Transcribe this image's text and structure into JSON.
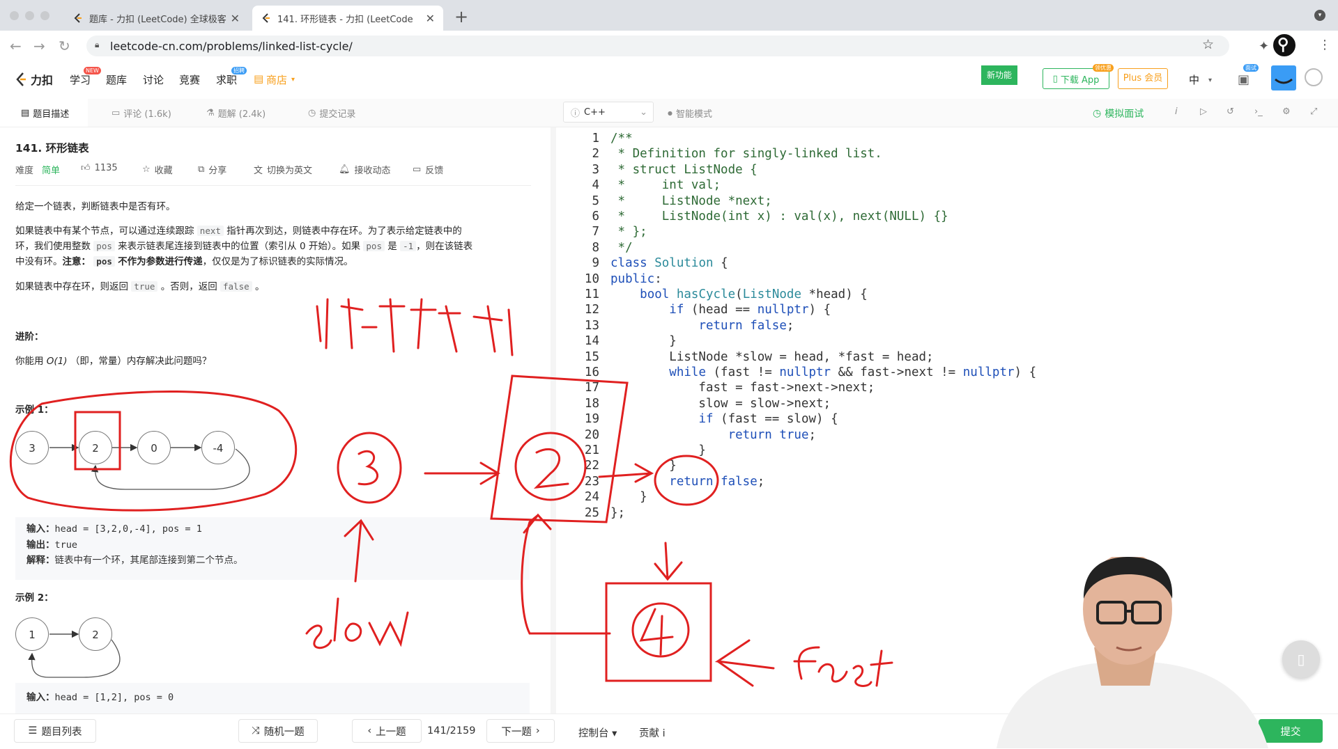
{
  "browser": {
    "tabs": [
      {
        "title": "题库 - 力扣 (LeetCode) 全球极客",
        "active": false
      },
      {
        "title": "141. 环形链表 - 力扣 (LeetCode",
        "active": true
      }
    ],
    "new_tab": "+",
    "url": "leetcode-cn.com/problems/linked-list-cycle/"
  },
  "site_header": {
    "logo_text": "力扣",
    "nav": [
      {
        "label": "学习",
        "badge": "NEW"
      },
      {
        "label": "题库"
      },
      {
        "label": "讨论"
      },
      {
        "label": "竞赛"
      },
      {
        "label": "求职",
        "badge": "招聘"
      },
      {
        "label": "商店"
      }
    ],
    "new_feature": "新功能",
    "download_app": "下载 App",
    "download_badge": "领优惠",
    "plus": "Plus 会员",
    "lang": "中",
    "interview_badge": "面试"
  },
  "sub_toolbar": {
    "tabs": [
      "题目描述",
      "评论 (1.6k)",
      "题解 (2.4k)",
      "提交记录"
    ],
    "language": "C++",
    "smart_mode": "智能模式",
    "mock_interview": "模拟面试"
  },
  "problem": {
    "title": "141. 环形链表",
    "difficulty_label": "难度",
    "difficulty": "简单",
    "likes": "1135",
    "favorite": "收藏",
    "share": "分享",
    "switch_english": "切换为英文",
    "subscribe": "接收动态",
    "feedback": "反馈",
    "desc_1": "给定一个链表，判断链表中是否有环。",
    "desc_2_a": "如果链表中有某个节点，可以通过连续跟踪",
    "code_next": "next",
    "desc_2_b": "指针再次到达，则链表中存在环。为了表示给定链表中的",
    "desc_2_c": "环，我们使用整数",
    "code_pos": "pos",
    "desc_2_d": "来表示链表尾连接到链表中的位置（索引从 0 开始）。如果",
    "desc_2_e": "是",
    "code_neg1": "-1",
    "desc_2_f": "，则在该链表",
    "desc_2_g": "中没有环。",
    "desc_2_note": "注意：",
    "desc_2_h": "不作为参数进行传递",
    "desc_2_i": "，仅仅是为了标识链表的实际情况。",
    "desc_3_a": "如果链表中存在环，则返回",
    "code_true": "true",
    "desc_3_b": "。否则，返回",
    "code_false": "false",
    "desc_3_c": "。",
    "advanced": "进阶：",
    "advanced_q_a": "你能用",
    "advanced_q_o": "O(1)",
    "advanced_q_b": "（即，常量）内存解决此问题吗？",
    "example1_title": "示例 1：",
    "example1_nodes": [
      "3",
      "2",
      "0",
      "-4"
    ],
    "example1_input_label": "输入：",
    "example1_input": "head = [3,2,0,-4], pos = 1",
    "example1_output_label": "输出：",
    "example1_output": "true",
    "example1_expl_label": "解释：",
    "example1_expl": "链表中有一个环，其尾部连接到第二个节点。",
    "example2_title": "示例 2：",
    "example2_nodes": [
      "1",
      "2"
    ],
    "example2_input_label": "输入：",
    "example2_input": "head = [1,2], pos = 0"
  },
  "code_lines": [
    {
      "n": "1",
      "html": "<span class=\"cm\">/**</span>"
    },
    {
      "n": "2",
      "html": "<span class=\"cm\"> * Definition for singly-linked list.</span>"
    },
    {
      "n": "3",
      "html": "<span class=\"cm\"> * struct ListNode {</span>"
    },
    {
      "n": "4",
      "html": "<span class=\"cm\"> *     int val;</span>"
    },
    {
      "n": "5",
      "html": "<span class=\"cm\"> *     ListNode *next;</span>"
    },
    {
      "n": "6",
      "html": "<span class=\"cm\"> *     ListNode(int x) : val(x), next(NULL) {}</span>"
    },
    {
      "n": "7",
      "html": "<span class=\"cm\"> * };</span>"
    },
    {
      "n": "8",
      "html": "<span class=\"cm\"> */</span>"
    },
    {
      "n": "9",
      "html": "<span class=\"kw\">class</span> <span class=\"ty\">Solution</span> {"
    },
    {
      "n": "10",
      "html": "<span class=\"kw\">public</span>:"
    },
    {
      "n": "11",
      "html": "    <span class=\"kw\">bool</span> <span class=\"ty\">hasCycle</span>(<span class=\"ty\">ListNode</span> *head) {"
    },
    {
      "n": "12",
      "html": "        <span class=\"kw\">if</span> (head == <span class=\"kw\">nullptr</span>) {"
    },
    {
      "n": "13",
      "html": "            <span class=\"kw\">return</span> <span class=\"kw\">false</span>;"
    },
    {
      "n": "14",
      "html": "        }"
    },
    {
      "n": "15",
      "html": "        ListNode *slow = head, *fast = head;"
    },
    {
      "n": "16",
      "html": "        <span class=\"kw\">while</span> (fast != <span class=\"kw\">nullptr</span> &amp;&amp; fast-&gt;next != <span class=\"kw\">nullptr</span>) {"
    },
    {
      "n": "17",
      "html": "            fast = fast-&gt;next-&gt;next;"
    },
    {
      "n": "18",
      "html": "            slow = slow-&gt;next;"
    },
    {
      "n": "19",
      "html": "            <span class=\"kw\">if</span> (fast == slow) {"
    },
    {
      "n": "20",
      "html": "                <span class=\"kw\">return</span> <span class=\"kw\">true</span>;"
    },
    {
      "n": "21",
      "html": "            }"
    },
    {
      "n": "22",
      "html": "        }"
    },
    {
      "n": "23",
      "html": "        <span class=\"kw\">return</span> <span class=\"kw\">false</span>;"
    },
    {
      "n": "24",
      "html": "    }"
    },
    {
      "n": "25",
      "html": "};"
    }
  ],
  "bottom_bar": {
    "problem_list": "题目列表",
    "random": "随机一题",
    "prev": "上一题",
    "counter": "141/2159",
    "next": "下一题",
    "console": "控制台",
    "contribute": "贡献 i",
    "submit": "提交"
  },
  "colors": {
    "accent_green": "#2db55d",
    "annotation_red": "#e02020",
    "keyword_blue": "#1e4fb8",
    "comment_green": "#2e6a35"
  }
}
